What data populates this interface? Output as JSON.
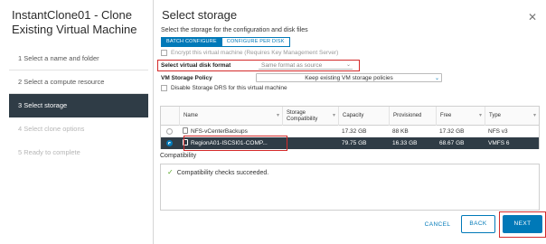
{
  "wizard": {
    "title": "InstantClone01 - Clone Existing Virtual Machine",
    "steps": [
      {
        "label": "1   Select a name and folder"
      },
      {
        "label": "2   Select a compute resource"
      },
      {
        "label": "3   Select storage"
      },
      {
        "label": "4   Select clone options"
      },
      {
        "label": "5   Ready to complete"
      }
    ],
    "active_step": 3
  },
  "main": {
    "title": "Select storage",
    "subtitle": "Select the storage for the configuration and disk files",
    "close_icon": "close-icon",
    "tabs": [
      {
        "label": "BATCH CONFIGURE",
        "selected": true
      },
      {
        "label": "CONFIGURE PER DISK",
        "selected": false
      }
    ],
    "encrypt_label": "Encrypt this virtual machine (Requires Key Management Server)",
    "disk_format": {
      "label": "Select virtual disk format",
      "value": "Same format as source"
    },
    "storage_policy": {
      "label": "VM Storage Policy",
      "value": "Keep existing VM storage policies"
    },
    "disable_drs_label": "Disable Storage DRS for this virtual machine"
  },
  "table": {
    "headers": [
      "Name",
      "Storage Compatibility",
      "Capacity",
      "Provisioned",
      "Free",
      "Type"
    ],
    "rows": [
      {
        "name": "NFS-vCenterBackups",
        "compat": "",
        "capacity": "17.32 GB",
        "provisioned": "88 KB",
        "free": "17.32 GB",
        "type": "NFS v3",
        "selected": false
      },
      {
        "name": "RegionA01-ISCSI01-COMP...",
        "compat": "",
        "capacity": "79.75 GB",
        "provisioned": "16.33 GB",
        "free": "68.67 GB",
        "type": "VMFS 6",
        "selected": true
      }
    ]
  },
  "compatibility": {
    "label": "Compatibility",
    "message": "Compatibility checks succeeded."
  },
  "footer": {
    "cancel": "CANCEL",
    "back": "BACK",
    "next": "NEXT"
  },
  "colors": {
    "accent": "#0079b8",
    "highlight": "#d42a2a",
    "selected_row": "#2f3c46",
    "success": "#5ba829"
  }
}
